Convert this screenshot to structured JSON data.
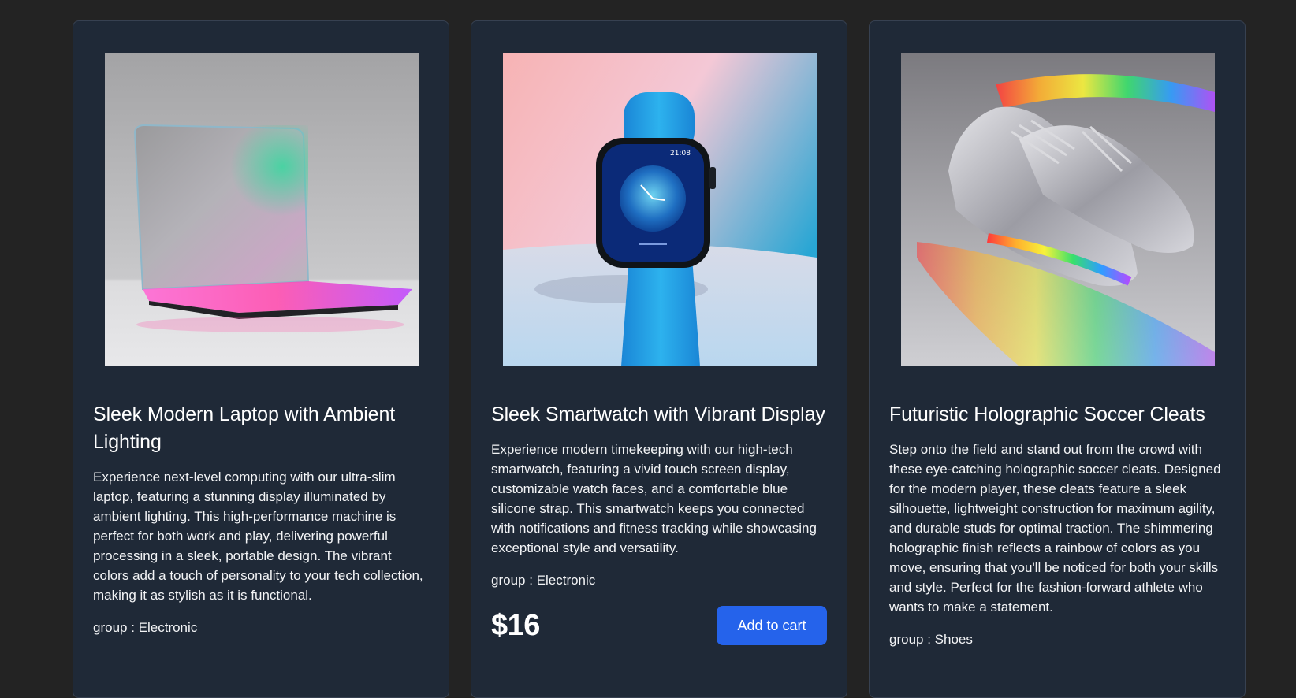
{
  "products": [
    {
      "title": "Sleek Modern Laptop with Ambient Lighting",
      "description": "Experience next-level computing with our ultra-slim laptop, featuring a stunning display illuminated by ambient lighting. This high-performance machine is perfect for both work and play, delivering powerful processing in a sleek, portable design. The vibrant colors add a touch of personality to your tech collection, making it as stylish as it is functional.",
      "group": "group : Electronic",
      "image": "laptop-photo"
    },
    {
      "title": "Sleek Smartwatch with Vibrant Display",
      "description": "Experience modern timekeeping with our high-tech smartwatch, featuring a vivid touch screen display, customizable watch faces, and a comfortable blue silicone strap. This smartwatch keeps you connected with notifications and fitness tracking while showcasing exceptional style and versatility.",
      "group": "group : Electronic",
      "price": "$16",
      "cart_label": "Add to cart",
      "image": "smartwatch-photo"
    },
    {
      "title": "Futuristic Holographic Soccer Cleats",
      "description": "Step onto the field and stand out from the crowd with these eye-catching holographic soccer cleats. Designed for the modern player, these cleats feature a sleek silhouette, lightweight construction for maximum agility, and durable studs for optimal traction. The shimmering holographic finish reflects a rainbow of colors as you move, ensuring that you'll be noticed for both your skills and style. Perfect for the fashion-forward athlete who wants to make a statement.",
      "group": "group : Shoes",
      "image": "soccer-cleats-photo"
    }
  ],
  "colors": {
    "page_background": "#232323",
    "card_background": "#1f2937",
    "button": "#2563eb"
  }
}
